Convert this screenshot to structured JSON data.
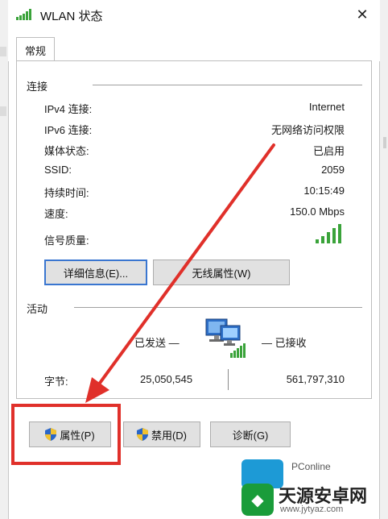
{
  "window": {
    "title": "WLAN 状态",
    "close_glyph": "✕"
  },
  "tabs": [
    {
      "label": "常规"
    }
  ],
  "connection": {
    "group_title": "连接",
    "rows": [
      {
        "label": "IPv4 连接:",
        "value": "Internet"
      },
      {
        "label": "IPv6 连接:",
        "value": "无网络访问权限"
      },
      {
        "label": "媒体状态:",
        "value": "已启用"
      },
      {
        "label": "SSID:",
        "value": "2059"
      },
      {
        "label": "持续时间:",
        "value": "10:15:49"
      },
      {
        "label": "速度:",
        "value": "150.0 Mbps"
      }
    ],
    "signal_label": "信号质量:",
    "signal_bars": 5,
    "details_button": "详细信息(E)...",
    "wireless_props_button": "无线属性(W)"
  },
  "activity": {
    "group_title": "活动",
    "sent_label": "已发送 —",
    "received_label": "— 已接收",
    "bytes_label": "字节:",
    "bytes_sent": "25,050,545",
    "bytes_received": "561,797,310"
  },
  "footer_buttons": {
    "properties": "属性(P)",
    "disable": "禁用(D)",
    "diagnose": "诊断(G)"
  },
  "watermarks": {
    "pconline": "PConline",
    "site_name": "天源安卓网",
    "site_url": "www.jytyaz.com"
  },
  "colors": {
    "annotation_red": "#e0302a",
    "signal_green": "#3aa33a",
    "default_button_blue": "#3a76d0"
  }
}
